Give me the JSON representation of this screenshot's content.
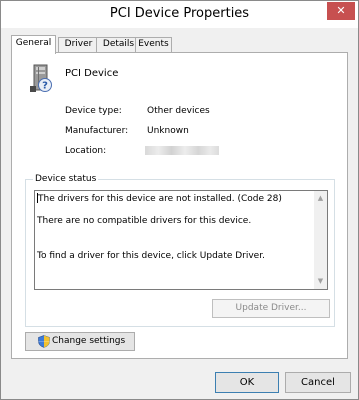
{
  "window": {
    "title": "PCI Device Properties",
    "close_glyph": "✕"
  },
  "tabs": [
    {
      "label": "General",
      "active": true
    },
    {
      "label": "Driver",
      "active": false
    },
    {
      "label": "Details",
      "active": false
    },
    {
      "label": "Events",
      "active": false
    }
  ],
  "device": {
    "name": "PCI Device",
    "icon": "pci-device-unknown-icon"
  },
  "properties": [
    {
      "label": "Device type:",
      "value": "Other devices"
    },
    {
      "label": "Manufacturer:",
      "value": "Unknown"
    },
    {
      "label": "Location:",
      "value": ""
    }
  ],
  "status": {
    "group_title": "Device status",
    "lines": [
      "The drivers for this device are not installed. (Code 28)",
      "There are no compatible drivers for this device.",
      "To find a driver for this device, click Update Driver."
    ]
  },
  "buttons": {
    "update_driver": "Update Driver...",
    "change_settings": "Change settings",
    "ok": "OK",
    "cancel": "Cancel"
  },
  "colors": {
    "close_button": "#c75050",
    "window_frame": "#f0f0f0",
    "default_button_border": "#3c7fb1"
  }
}
